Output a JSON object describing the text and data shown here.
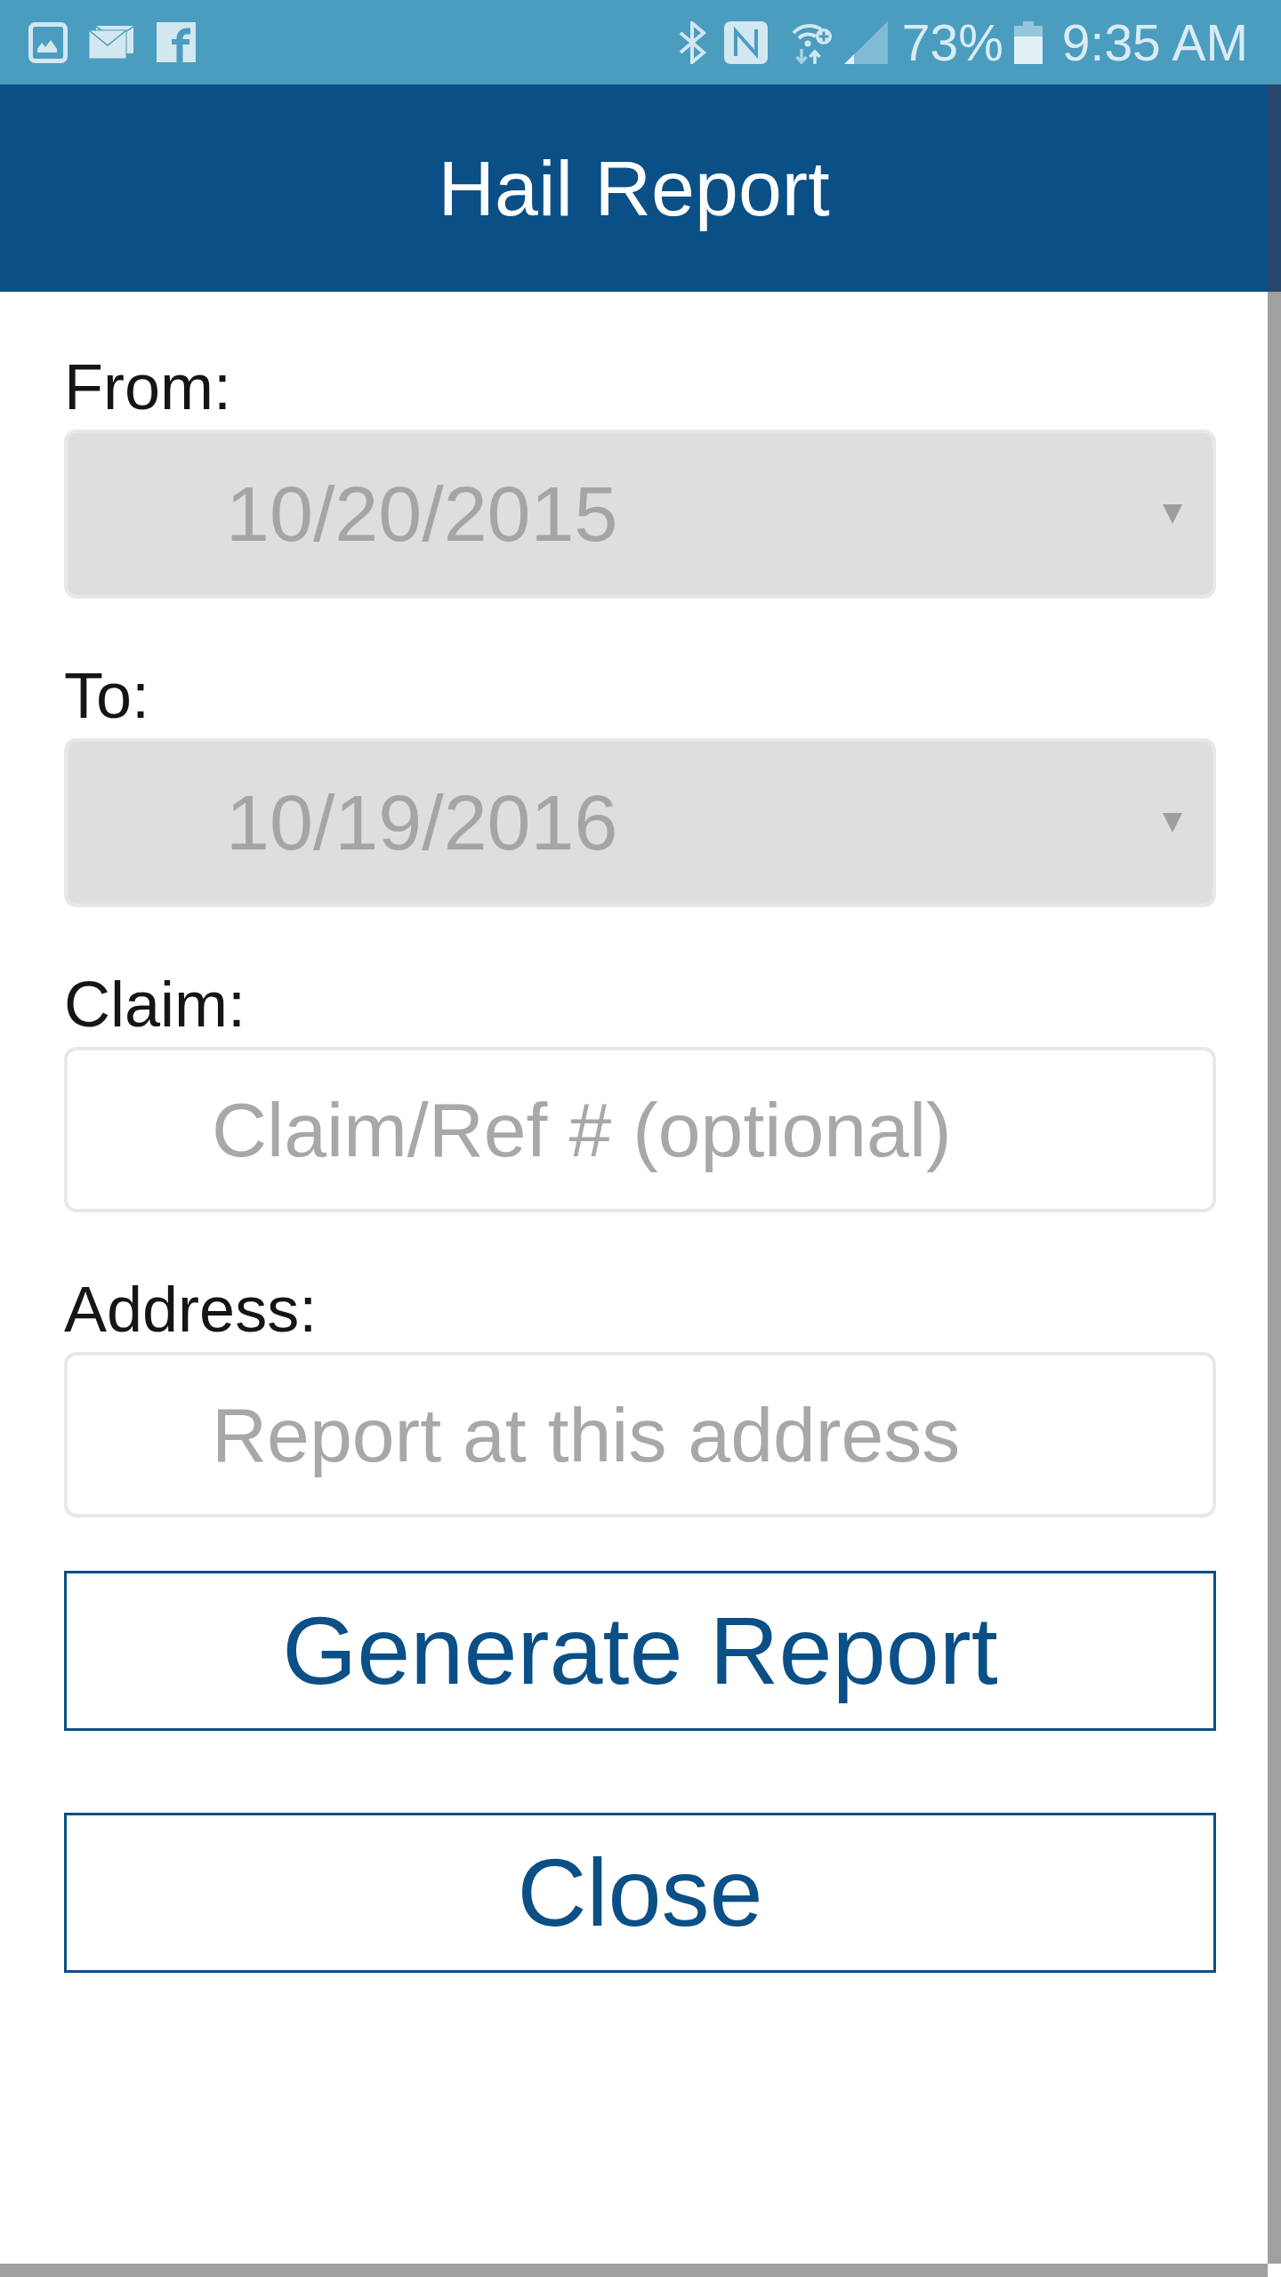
{
  "status_bar": {
    "battery": "73%",
    "time": "9:35 AM"
  },
  "header": {
    "title": "Hail Report"
  },
  "fields": [
    {
      "label": "From:",
      "kind": "date",
      "value": "10/20/2015",
      "disabled": true
    },
    {
      "label": "To:",
      "kind": "date",
      "value": "10/19/2016",
      "disabled": true
    },
    {
      "label": "Claim:",
      "kind": "text",
      "placeholder": "Claim/Ref # (optional)",
      "disabled": false
    },
    {
      "label": "Address:",
      "kind": "text",
      "placeholder": "Report at this address",
      "disabled": false
    }
  ],
  "buttons": [
    "Generate Report",
    "Close"
  ]
}
